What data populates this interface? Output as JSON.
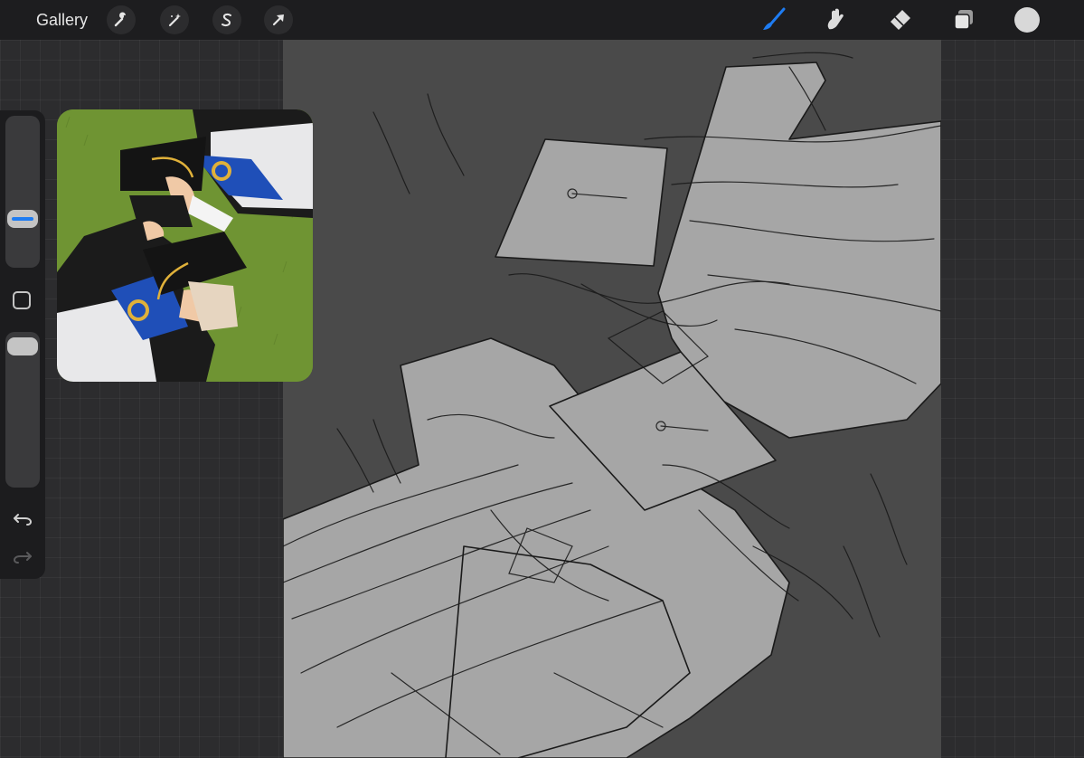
{
  "topbar": {
    "gallery_label": "Gallery",
    "actions": [
      {
        "name": "actions",
        "icon": "wrench-icon"
      },
      {
        "name": "adjustments",
        "icon": "magic-wand-icon"
      },
      {
        "name": "selection",
        "icon": "selection-s-icon"
      },
      {
        "name": "transform",
        "icon": "arrow-cursor-icon"
      }
    ],
    "tools": [
      {
        "name": "brush",
        "icon": "brush-icon",
        "active": true
      },
      {
        "name": "smudge",
        "icon": "smudge-icon",
        "active": false
      },
      {
        "name": "eraser",
        "icon": "eraser-icon",
        "active": false
      },
      {
        "name": "layers",
        "icon": "layers-icon",
        "active": false
      }
    ],
    "current_color": "#d8d8d8"
  },
  "sidebar": {
    "brush_size_level": 0.3,
    "opacity_level": 0.96,
    "modify_icon": "square-icon",
    "undo_icon": "undo-icon",
    "redo_icon": "redo-icon",
    "redo_enabled": false
  },
  "reference": {
    "icon": "reference-photo-graduates"
  },
  "colors": {
    "accent": "#1e7cf2",
    "toolbar_bg": "#1d1d1f",
    "workspace_bg": "#2c2c2e",
    "canvas_bg": "#4a4a4a",
    "sketch_fill": "#a6a6a6",
    "grass": "#6f9433",
    "gown": "#1b1b1b",
    "hood_blue": "#1f4fb8",
    "tassel": "#e0b13a"
  }
}
